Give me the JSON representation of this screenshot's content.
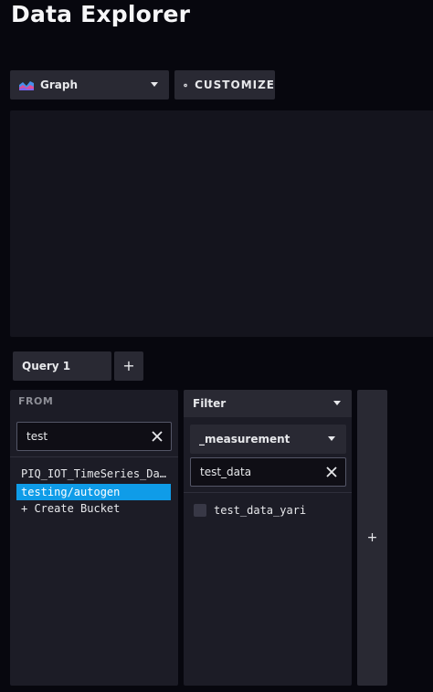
{
  "page": {
    "title": "Data Explorer"
  },
  "toolbar": {
    "graph_type_label": "Graph",
    "customize_label": "CUSTOMIZE",
    "graph_icon": "graph-icon",
    "customize_icon": "gear-icon"
  },
  "query": {
    "tabs": [
      {
        "label": "Query 1"
      }
    ],
    "add_tab_label": "+"
  },
  "from": {
    "label": "FROM",
    "search_value": "test",
    "buckets": [
      {
        "label": "PIQ_IOT_TimeSeries_Data"
      },
      {
        "label": "testing/autogen",
        "selected": true
      },
      {
        "label": "+ Create Bucket"
      }
    ]
  },
  "filter": {
    "header_label": "Filter",
    "key_select_label": "_measurement",
    "search_value": "test_data",
    "values": [
      {
        "label": "test_data_yari",
        "checked": false
      }
    ]
  },
  "add_filter_label": "+",
  "colors": {
    "background": "#07070e",
    "panel": "#1c1c26",
    "button": "#292933",
    "selected": "#0f9ce8",
    "accent_pink": "#dc4e9a",
    "accent_blue": "#4591ed"
  }
}
